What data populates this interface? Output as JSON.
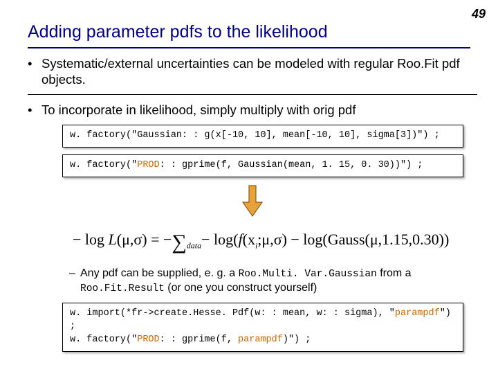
{
  "page_number": "49",
  "title": "Adding parameter pdfs to the likelihood",
  "bullets": [
    "Systematic/external uncertainties can be modeled with regular Roo.Fit pdf objects.",
    "To incorporate in likelihood, simply multiply with orig pdf"
  ],
  "code1": {
    "text": "w. factory(\"Gaussian: : g(x[-10, 10], mean[-10, 10], sigma[3])\") ;"
  },
  "code2": {
    "prefix": "w. factory(\"",
    "kw": "PROD",
    "suffix": ": : gprime(f, Gaussian(mean, 1. 15, 0. 30))\") ;"
  },
  "formula": {
    "lhs_pre": "− log ",
    "lhs_L": "L",
    "lhs_args": "(μ,σ) = −",
    "sum_sub": "data",
    "term1_pre": "− log(",
    "term1_f": "f",
    "term1_args": "(x",
    "term1_sub": "i",
    "term1_post": ";μ,σ)",
    "term2": " − log(Gauss(μ,1.15,0.30))"
  },
  "sub_bullet": {
    "pre": "Any pdf can be supplied, e. g. a ",
    "mono1": "Roo.Multi. Var.Gaussian",
    "mid": " from a ",
    "mono2": "Roo.Fit.Result",
    "post": " (or one you construct yourself)"
  },
  "code3": {
    "line1_pre": "w. import(*fr->create.Hesse. Pdf(w: : mean, w: : sigma), \"",
    "line1_kw": "parampdf",
    "line1_post": "\") ;",
    "line2_pre": "w. factory(\"",
    "line2_kw1": "PROD",
    "line2_mid": ": : gprime(f, ",
    "line2_kw2": "parampdf",
    "line2_post": ")\") ;"
  },
  "colors": {
    "title": "#000080",
    "keyword": "#cc6600",
    "arrow_fill": "#e8a23a",
    "arrow_stroke": "#8a5a15"
  }
}
